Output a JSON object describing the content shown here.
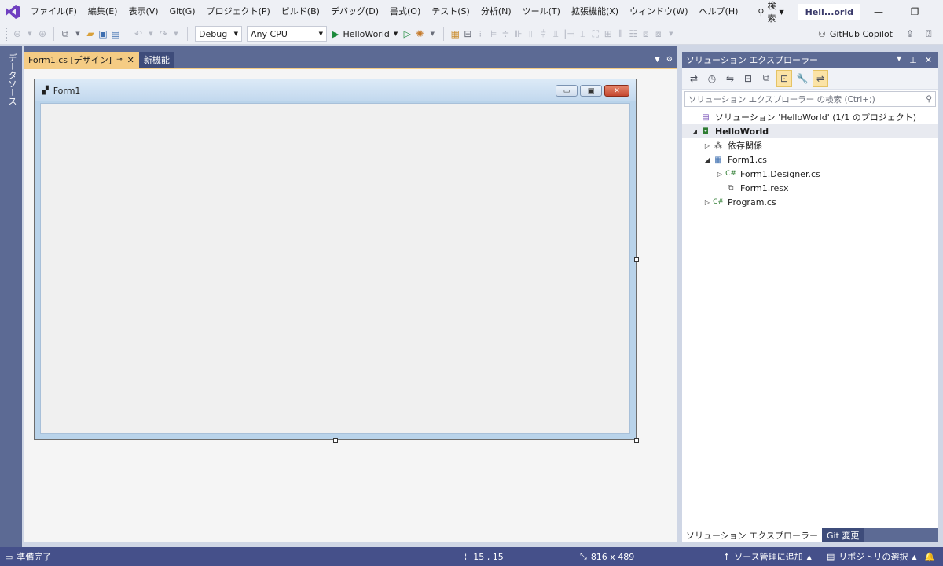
{
  "menu": [
    "ファイル(F)",
    "編集(E)",
    "表示(V)",
    "Git(G)",
    "プロジェクト(P)",
    "ビルド(B)",
    "デバッグ(D)",
    "書式(O)",
    "テスト(S)",
    "分析(N)",
    "ツール(T)",
    "拡張機能(X)",
    "ウィンドウ(W)",
    "ヘルプ(H)"
  ],
  "search_label": "検索",
  "title_badge": "Hell...orld",
  "toolbar": {
    "config": "Debug",
    "platform": "Any CPU",
    "run_target": "HelloWorld",
    "copilot": "GitHub Copilot"
  },
  "left_rail_label": "データソース",
  "tabs": {
    "active": "Form1.cs [デザイン]",
    "other": "新機能"
  },
  "form": {
    "title": "Form1"
  },
  "solution_explorer": {
    "title": "ソリューション エクスプローラー",
    "search_placeholder": "ソリューション エクスプローラー の検索 (Ctrl+;)",
    "nodes": [
      {
        "label": "ソリューション 'HelloWorld' (1/1 のプロジェクト)",
        "icon": "solution-icon",
        "expander": ""
      },
      {
        "label": "HelloWorld",
        "icon": "csharp-project-icon",
        "expander": "expanded",
        "bold": true
      },
      {
        "label": "依存関係",
        "icon": "dependencies-icon",
        "expander": "collapsed"
      },
      {
        "label": "Form1.cs",
        "icon": "form-icon",
        "expander": "expanded"
      },
      {
        "label": "Form1.Designer.cs",
        "icon": "csharp-file-icon",
        "expander": "collapsed"
      },
      {
        "label": "Form1.resx",
        "icon": "resx-icon",
        "expander": ""
      },
      {
        "label": "Program.cs",
        "icon": "csharp-file-icon",
        "expander": "collapsed"
      }
    ],
    "bottom_tabs": [
      "ソリューション エクスプローラー",
      "Git 変更"
    ]
  },
  "status": {
    "ready": "準備完了",
    "position": "15 , 15",
    "size": "816 x 489",
    "source_control": "ソース管理に追加",
    "repository": "リポジトリの選択"
  }
}
